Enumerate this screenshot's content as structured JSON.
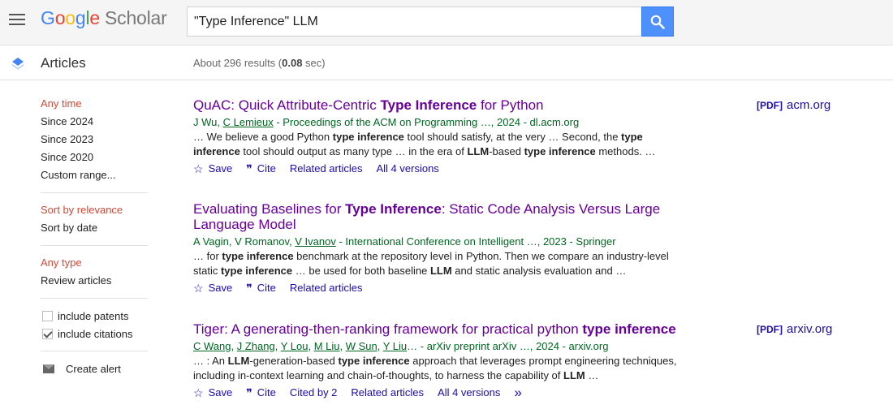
{
  "header": {
    "logo_letters": [
      "G",
      "o",
      "o",
      "g",
      "l",
      "e"
    ],
    "logo_suffix": "Scholar",
    "search_value": "\"Type Inference\" LLM"
  },
  "subbar": {
    "section": "Articles",
    "results_prefix": "About 296 results (",
    "results_time": "0.08",
    "results_suffix": " sec)"
  },
  "sidebar": {
    "time": [
      "Any time",
      "Since 2024",
      "Since 2023",
      "Since 2020",
      "Custom range..."
    ],
    "sort": [
      "Sort by relevance",
      "Sort by date"
    ],
    "type": [
      "Any type",
      "Review articles"
    ],
    "include_patents": "include patents",
    "include_citations": "include citations",
    "create_alert": "Create alert"
  },
  "results": [
    {
      "title_parts": [
        [
          "QuAC: Quick Attribute-Centric ",
          false
        ],
        [
          "Type Inference",
          true
        ],
        [
          " for Python",
          false
        ]
      ],
      "authors_parts": [
        [
          "J Wu, ",
          false
        ],
        [
          "C Lemieux",
          true
        ],
        [
          " - Proceedings of the ACM on Programming …, 2024 - dl.acm.org",
          false
        ]
      ],
      "snippet_parts": [
        [
          "… We believe a good Python ",
          false
        ],
        [
          "type inference",
          true
        ],
        [
          " tool should satisfy, at the very … Second, the ",
          false
        ],
        [
          "type inference",
          true
        ],
        [
          " tool should output as many type … in the era of ",
          false
        ],
        [
          "LLM",
          true
        ],
        [
          "-based ",
          false
        ],
        [
          "type inference",
          true
        ],
        [
          " methods. …",
          false
        ]
      ],
      "actions": [
        "Save",
        "Cite",
        "Related articles",
        "All 4 versions"
      ],
      "pdf": {
        "tag": "[PDF]",
        "source": "acm.org"
      }
    },
    {
      "title_parts": [
        [
          "Evaluating Baselines for ",
          false
        ],
        [
          "Type Inference",
          true
        ],
        [
          ": Static Code Analysis Versus Large Language Model",
          false
        ]
      ],
      "authors_parts": [
        [
          "A Vagin, V Romanov, ",
          false
        ],
        [
          "V Ivanov",
          true
        ],
        [
          " - International Conference on Intelligent …, 2023 - Springer",
          false
        ]
      ],
      "snippet_parts": [
        [
          "… for ",
          false
        ],
        [
          "type inference",
          true
        ],
        [
          " benchmark at the repository level in Python. Then we compare an industry-level static ",
          false
        ],
        [
          "type inference",
          true
        ],
        [
          " … be used for both baseline ",
          false
        ],
        [
          "LLM",
          true
        ],
        [
          " and static analysis evaluation and …",
          false
        ]
      ],
      "actions": [
        "Save",
        "Cite",
        "Related articles"
      ],
      "pdf": null
    },
    {
      "title_parts": [
        [
          "Tiger: A generating-then-ranking framework for practical python ",
          false
        ],
        [
          "type inference",
          true
        ]
      ],
      "authors_parts": [
        [
          "C Wang",
          true
        ],
        [
          ", ",
          false
        ],
        [
          "J Zhang",
          true
        ],
        [
          ", ",
          false
        ],
        [
          "Y Lou",
          true
        ],
        [
          ", ",
          false
        ],
        [
          "M Liu",
          true
        ],
        [
          ", ",
          false
        ],
        [
          "W Sun",
          true
        ],
        [
          ", ",
          false
        ],
        [
          "Y Liu",
          true
        ],
        [
          "… - arXiv preprint arXiv …, 2024 - arxiv.org",
          false
        ]
      ],
      "snippet_parts": [
        [
          "… : An ",
          false
        ],
        [
          "LLM",
          true
        ],
        [
          "-generation-based ",
          false
        ],
        [
          "type inference",
          true
        ],
        [
          " approach that leverages prompt engineering techniques, including in-context learning and chain-of-thoughts, to harness the capability of ",
          false
        ],
        [
          "LLM",
          true
        ],
        [
          " …",
          false
        ]
      ],
      "actions": [
        "Save",
        "Cite",
        "Cited by 2",
        "Related articles",
        "All 4 versions"
      ],
      "more_glyph": "»",
      "pdf": {
        "tag": "[PDF]",
        "source": "arxiv.org"
      }
    }
  ],
  "colors": {
    "link": "#1a0dab",
    "title_visited": "#660099",
    "authors_green": "#006621",
    "sidebar_active": "#d14836",
    "search_button": "#4d90fe"
  },
  "icons": {
    "menu": "hamburger-icon",
    "search": "magnifier-icon",
    "articles": "articles-diamond-icon",
    "save": "star-outline-icon",
    "cite": "quote-icon",
    "more": "double-chevron-icon",
    "alert": "mail-icon"
  }
}
